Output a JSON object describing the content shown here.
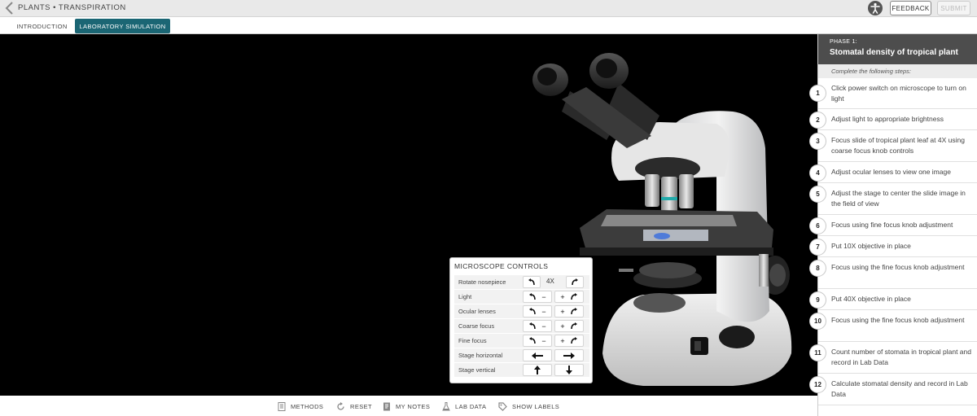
{
  "header": {
    "breadcrumb": "PLANTS • TRANSPIRATION",
    "feedback_label": "FEEDBACK",
    "submit_label": "SUBMIT"
  },
  "tabs": [
    {
      "label": "INTRODUCTION",
      "active": false
    },
    {
      "label": "LABORATORY SIMULATION",
      "active": true
    }
  ],
  "microscope_controls": {
    "title": "MICROSCOPE CONTROLS",
    "rows": [
      {
        "label": "Rotate nosepiece",
        "value": "4X"
      },
      {
        "label": "Light",
        "minus": "−",
        "plus": "+"
      },
      {
        "label": "Ocular lenses",
        "minus": "−",
        "plus": "+"
      },
      {
        "label": "Coarse focus",
        "minus": "−",
        "plus": "+"
      },
      {
        "label": "Fine focus",
        "minus": "−",
        "plus": "+"
      },
      {
        "label": "Stage horizontal"
      },
      {
        "label": "Stage vertical"
      }
    ]
  },
  "phase": {
    "number": "PHASE 1:",
    "title": "Stomatal density of tropical plant",
    "subtitle": "Complete the following steps:",
    "steps": [
      {
        "num": "1",
        "text": "Click power switch on microscope to turn on light"
      },
      {
        "num": "2",
        "text": "Adjust light to appropriate brightness"
      },
      {
        "num": "3",
        "text": "Focus slide of tropical plant leaf at 4X using coarse focus knob controls"
      },
      {
        "num": "4",
        "text": "Adjust ocular lenses to view one image"
      },
      {
        "num": "5",
        "text": "Adjust the stage to center the slide image in the field of view"
      },
      {
        "num": "6",
        "text": "Focus using fine focus knob adjustment"
      },
      {
        "num": "7",
        "text": "Put 10X objective in place"
      },
      {
        "num": "8",
        "text": "Focus using the fine focus knob adjustment"
      },
      {
        "num": "9",
        "text": "Put 40X objective in place"
      },
      {
        "num": "10",
        "text": "Focus using the fine focus knob adjustment"
      },
      {
        "num": "11",
        "text": "Count number of stomata in tropical plant and record in Lab Data"
      },
      {
        "num": "12",
        "text": "Calculate stomatal density and record in Lab Data"
      }
    ]
  },
  "bottom_toolbar": {
    "methods": "METHODS",
    "reset": "RESET",
    "my_notes": "MY NOTES",
    "lab_data": "LAB DATA",
    "show_labels": "SHOW LABELS"
  },
  "colors": {
    "accent": "#1b6674",
    "phase_header": "#4d4d4d",
    "sim_background": "#000000"
  }
}
